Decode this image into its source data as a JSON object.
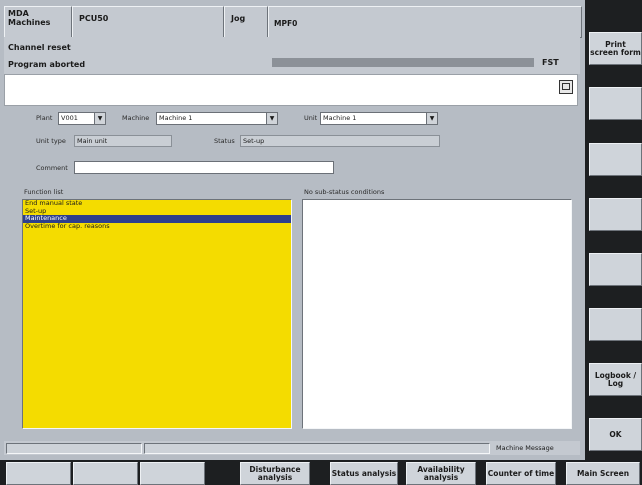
{
  "header": {
    "area": "MDA\nMachines",
    "channel": "PCU50",
    "mode": "Jog",
    "program": "MPF0",
    "channel_status": "Channel reset",
    "program_status": "Program aborted",
    "fst_label": "FST"
  },
  "form": {
    "plant_label": "Plant",
    "plant_value": "V001",
    "machine_label": "Machine",
    "machine_value": "Machine 1",
    "unit_label": "Unit",
    "unit_value": "Machine 1",
    "unit_type_label": "Unit type",
    "unit_type_value": "Main unit",
    "status_label": "Status",
    "status_value": "Set-up",
    "comment_label": "Comment",
    "comment_value": ""
  },
  "function_list": {
    "title": "Function list",
    "items": [
      "End manual state",
      "Set-up",
      "Maintenance",
      "Overtime for cap. reasons"
    ],
    "selected_index": 2
  },
  "substatus": {
    "title": "No sub-status conditions"
  },
  "message_bar": {
    "label": "Machine Message"
  },
  "right_softkeys": [
    "Print screen form",
    "",
    "",
    "",
    "",
    "",
    "Logbook / Log",
    "OK"
  ],
  "bottom_softkeys": [
    "",
    "",
    "",
    "Disturbance analysis",
    "Status analysis",
    "Availability analysis",
    "Counter of time",
    "Main Screen"
  ],
  "colors": {
    "list_bg": "#f4dc00",
    "selection": "#2d3f8c",
    "softkey_dark": "#222222"
  }
}
